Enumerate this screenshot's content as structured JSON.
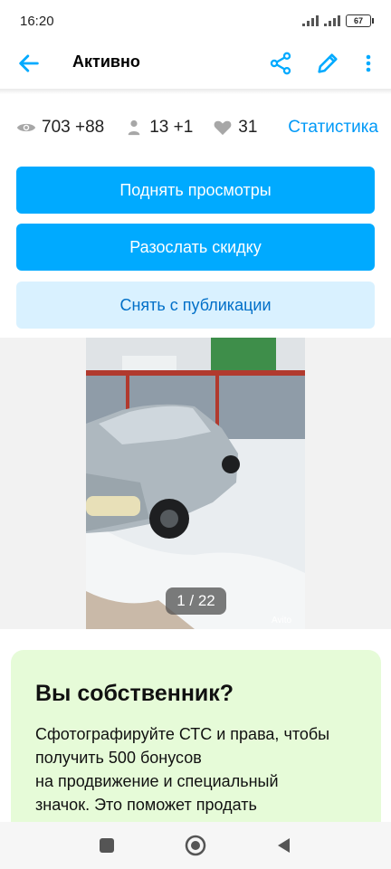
{
  "status": {
    "time": "16:20",
    "battery": "67"
  },
  "header": {
    "title": "Активно",
    "back_icon": "arrow-left-icon",
    "share_icon": "share-icon",
    "edit_icon": "pencil-icon",
    "more_icon": "more-vertical-icon",
    "accent": "#00aaff"
  },
  "stats": {
    "views": "703 +88",
    "contacts": "13 +1",
    "favorites": "31",
    "stats_link": "Статистика"
  },
  "actions": {
    "raise_views": "Поднять просмотры",
    "send_discount": "Разослать скидку",
    "unpublish": "Снять с публикации"
  },
  "gallery": {
    "counter": "1 / 22",
    "watermark": "Avito"
  },
  "promo": {
    "title": "Вы собственник?",
    "text": "Сфотографируйте СТС и права, чтобы\nполучить 500 бонусов\nна продвижение и специальный\nзначок. Это поможет продать"
  },
  "nav": {
    "recents_icon": "square-icon",
    "home_icon": "circle-home-icon",
    "back_icon": "triangle-back-icon"
  }
}
